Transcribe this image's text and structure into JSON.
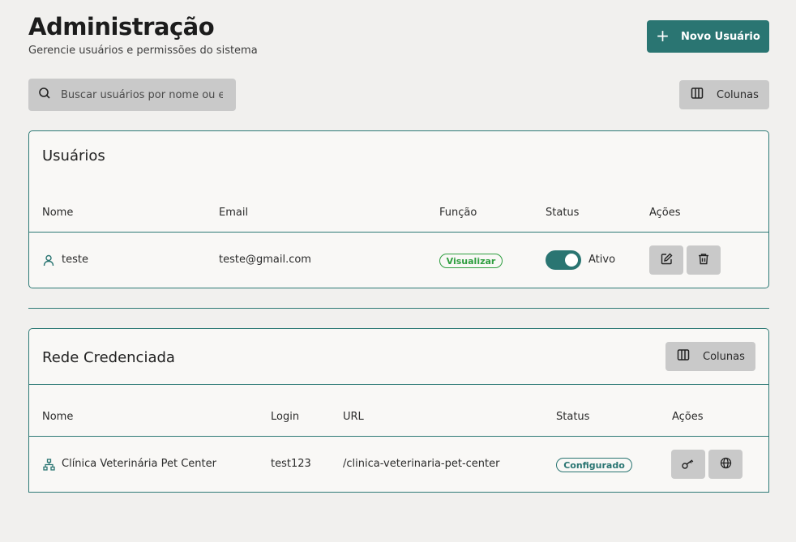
{
  "header": {
    "title": "Administração",
    "subtitle": "Gerencie usuários e permissões do sistema",
    "new_user_label": "Novo Usuário"
  },
  "search": {
    "placeholder": "Buscar usuários por nome ou email",
    "value": ""
  },
  "columns_label": "Colunas",
  "users_card": {
    "title": "Usuários",
    "columns": [
      "Nome",
      "Email",
      "Função",
      "Status",
      "Ações"
    ],
    "rows": [
      {
        "name": "teste",
        "email": "teste@gmail.com",
        "role": "Visualizar",
        "status": "Ativo",
        "active": true
      }
    ]
  },
  "network_card": {
    "title": "Rede Credenciada",
    "columns_label": "Colunas",
    "columns": [
      "Nome",
      "Login",
      "URL",
      "Status",
      "Ações"
    ],
    "rows": [
      {
        "name": "Clínica Veterinária Pet Center",
        "login": "test123",
        "url": "/clinica-veterinaria-pet-center",
        "status": "Configurado"
      }
    ]
  },
  "colors": {
    "accent": "#2a7572",
    "role_badge": "#2e9e3f",
    "background": "#f1f0ee",
    "button_gray": "#c9c9c9"
  },
  "icons": [
    "plus-icon",
    "search-icon",
    "columns-icon",
    "user-icon",
    "edit-icon",
    "trash-icon",
    "network-icon",
    "key-icon",
    "globe-icon"
  ]
}
